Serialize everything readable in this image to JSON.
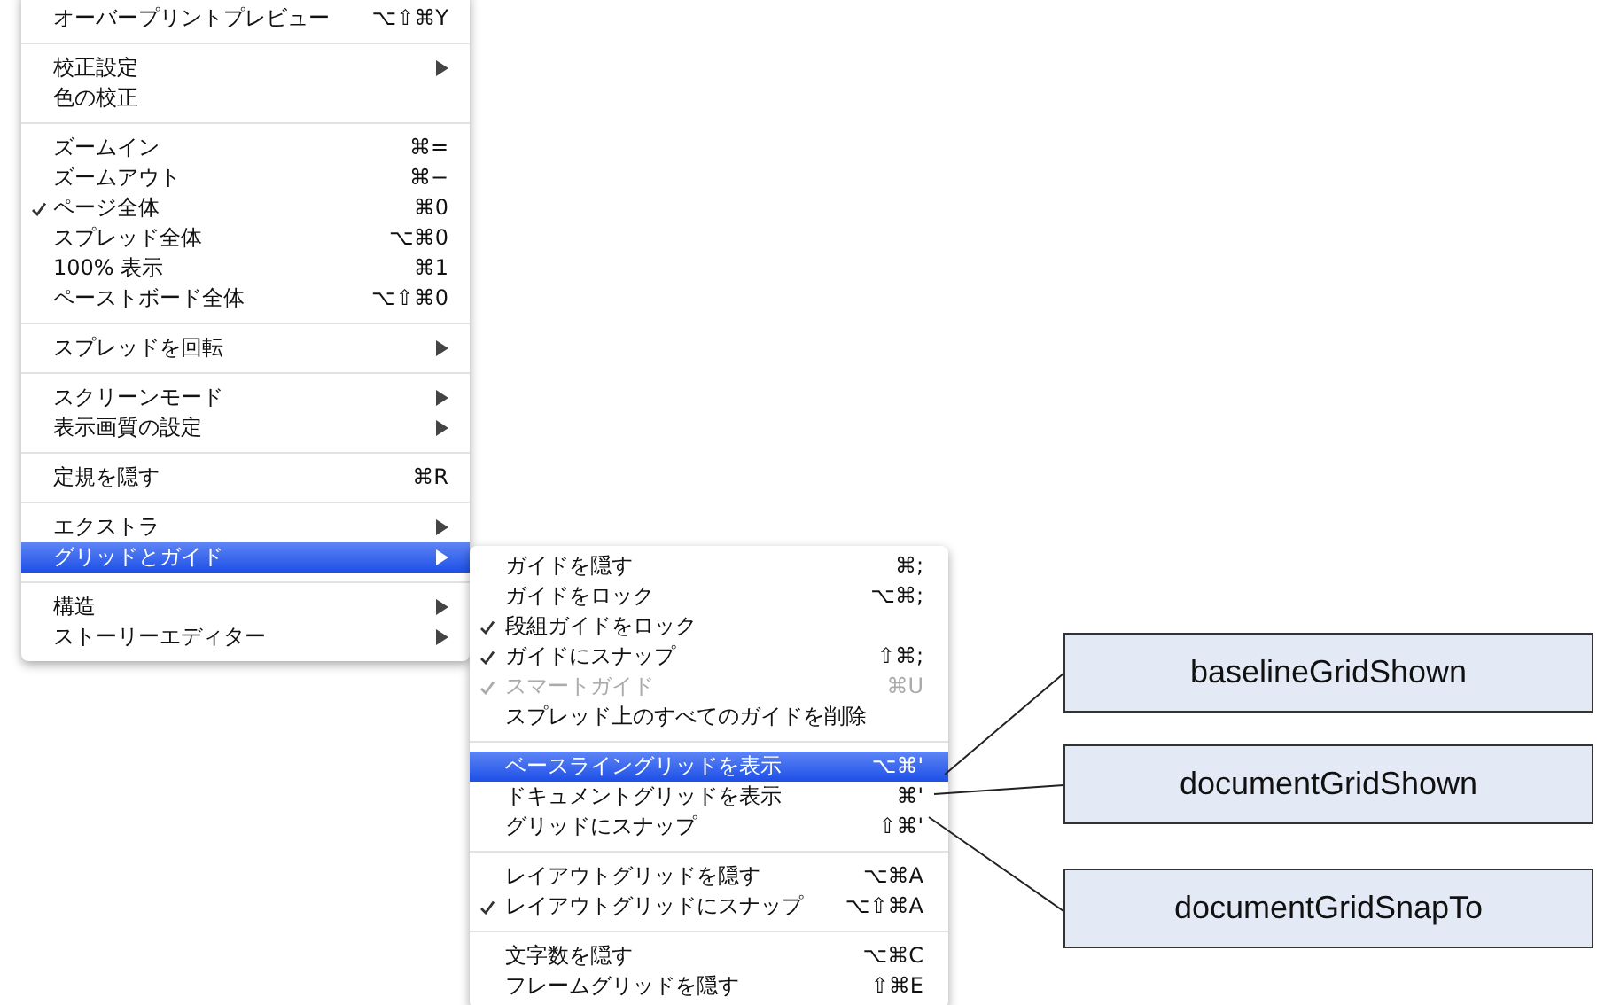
{
  "view_menu": {
    "groups": [
      {
        "items": [
          {
            "label": "オーバープリントプレビュー",
            "shortcut": "⌥⇧⌘Y",
            "checked": false,
            "disabled": false,
            "selected": false,
            "has_submenu": false
          }
        ]
      },
      {
        "items": [
          {
            "label": "校正設定",
            "checked": false,
            "disabled": false,
            "selected": false,
            "has_submenu": true
          },
          {
            "label": "色の校正",
            "checked": false,
            "disabled": false,
            "selected": false,
            "has_submenu": false
          }
        ]
      },
      {
        "items": [
          {
            "label": "ズームイン",
            "shortcut": "⌘=",
            "checked": false,
            "disabled": false,
            "selected": false,
            "has_submenu": false
          },
          {
            "label": "ズームアウト",
            "shortcut": "⌘−",
            "checked": false,
            "disabled": false,
            "selected": false,
            "has_submenu": false
          },
          {
            "label": "ページ全体",
            "shortcut": "⌘0",
            "checked": true,
            "disabled": false,
            "selected": false,
            "has_submenu": false
          },
          {
            "label": "スプレッド全体",
            "shortcut": "⌥⌘0",
            "checked": false,
            "disabled": false,
            "selected": false,
            "has_submenu": false
          },
          {
            "label": "100% 表示",
            "shortcut": "⌘1",
            "checked": false,
            "disabled": false,
            "selected": false,
            "has_submenu": false
          },
          {
            "label": "ペーストボード全体",
            "shortcut": "⌥⇧⌘0",
            "checked": false,
            "disabled": false,
            "selected": false,
            "has_submenu": false
          }
        ]
      },
      {
        "items": [
          {
            "label": "スプレッドを回転",
            "checked": false,
            "disabled": false,
            "selected": false,
            "has_submenu": true
          }
        ]
      },
      {
        "items": [
          {
            "label": "スクリーンモード",
            "checked": false,
            "disabled": false,
            "selected": false,
            "has_submenu": true
          },
          {
            "label": "表示画質の設定",
            "checked": false,
            "disabled": false,
            "selected": false,
            "has_submenu": true
          }
        ]
      },
      {
        "items": [
          {
            "label": "定規を隠す",
            "shortcut": "⌘R",
            "checked": false,
            "disabled": false,
            "selected": false,
            "has_submenu": false
          }
        ]
      },
      {
        "items": [
          {
            "label": "エクストラ",
            "checked": false,
            "disabled": false,
            "selected": false,
            "has_submenu": true
          },
          {
            "label": "グリッドとガイド",
            "checked": false,
            "disabled": false,
            "selected": true,
            "has_submenu": true
          }
        ]
      },
      {
        "items": [
          {
            "label": "構造",
            "checked": false,
            "disabled": false,
            "selected": false,
            "has_submenu": true
          },
          {
            "label": "ストーリーエディター",
            "checked": false,
            "disabled": false,
            "selected": false,
            "has_submenu": true
          }
        ]
      }
    ]
  },
  "grids_guides_submenu": {
    "groups": [
      {
        "items": [
          {
            "label": "ガイドを隠す",
            "shortcut": "⌘;",
            "checked": false,
            "disabled": false,
            "selected": false
          },
          {
            "label": "ガイドをロック",
            "shortcut": "⌥⌘;",
            "checked": false,
            "disabled": false,
            "selected": false
          },
          {
            "label": "段組ガイドをロック",
            "checked": true,
            "disabled": false,
            "selected": false
          },
          {
            "label": "ガイドにスナップ",
            "shortcut": "⇧⌘;",
            "checked": true,
            "disabled": false,
            "selected": false
          },
          {
            "label": "スマートガイド",
            "shortcut": "⌘U",
            "checked": true,
            "disabled": true,
            "selected": false
          },
          {
            "label": "スプレッド上のすべてのガイドを削除",
            "checked": false,
            "disabled": false,
            "selected": false
          }
        ]
      },
      {
        "items": [
          {
            "label": "ベースライングリッドを表示",
            "shortcut": "⌥⌘'",
            "checked": false,
            "disabled": false,
            "selected": true
          },
          {
            "label": "ドキュメントグリッドを表示",
            "shortcut": "⌘'",
            "checked": false,
            "disabled": false,
            "selected": false
          },
          {
            "label": "グリッドにスナップ",
            "shortcut": "⇧⌘'",
            "checked": false,
            "disabled": false,
            "selected": false
          }
        ]
      },
      {
        "items": [
          {
            "label": "レイアウトグリッドを隠す",
            "shortcut": "⌥⌘A",
            "checked": false,
            "disabled": false,
            "selected": false
          },
          {
            "label": "レイアウトグリッドにスナップ",
            "shortcut": "⌥⇧⌘A",
            "checked": true,
            "disabled": false,
            "selected": false
          }
        ]
      },
      {
        "items": [
          {
            "label": "文字数を隠す",
            "shortcut": "⌥⌘C",
            "checked": false,
            "disabled": false,
            "selected": false
          },
          {
            "label": "フレームグリッドを隠す",
            "shortcut": "⇧⌘E",
            "checked": false,
            "disabled": false,
            "selected": false
          }
        ]
      }
    ]
  },
  "callouts": [
    {
      "label": "baselineGridShown"
    },
    {
      "label": "documentGridShown"
    },
    {
      "label": "documentGridSnapTo"
    }
  ]
}
